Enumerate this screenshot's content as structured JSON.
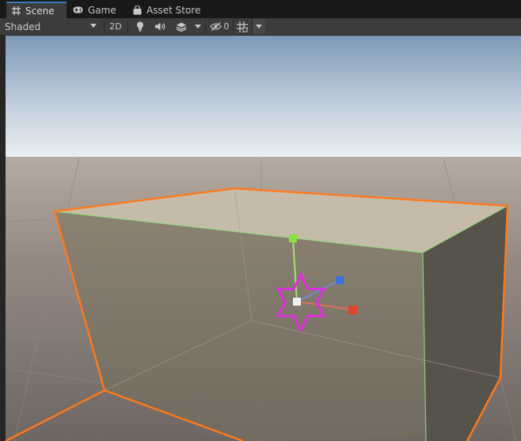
{
  "tabs": [
    {
      "label": "Scene",
      "icon": "grid-icon",
      "active": true
    },
    {
      "label": "Game",
      "icon": "gamepad-icon",
      "active": false
    },
    {
      "label": "Asset Store",
      "icon": "shopping-bag-icon",
      "active": false
    }
  ],
  "toolbar": {
    "draw_mode": "Shaded",
    "toggle_2d": "2D",
    "lighting_icon": "lightbulb-icon",
    "audio_icon": "speaker-icon",
    "effects_icon": "layers-icon",
    "effects_dropdown_icon": "chevron-down-icon",
    "hidden_icon": "eye-slash-icon",
    "hidden_count": "0",
    "grid_icon": "grid-snap-icon",
    "grid_dropdown_icon": "chevron-down-icon"
  },
  "scene": {
    "selection_outline_color": "#ff7a1a",
    "gizmo_colors": {
      "x": "#e0442a",
      "y": "#8be03a",
      "z": "#3a6fe0"
    },
    "light_gizmo_color": "#e22be0",
    "light_gizmo_icon": "star-icon"
  }
}
